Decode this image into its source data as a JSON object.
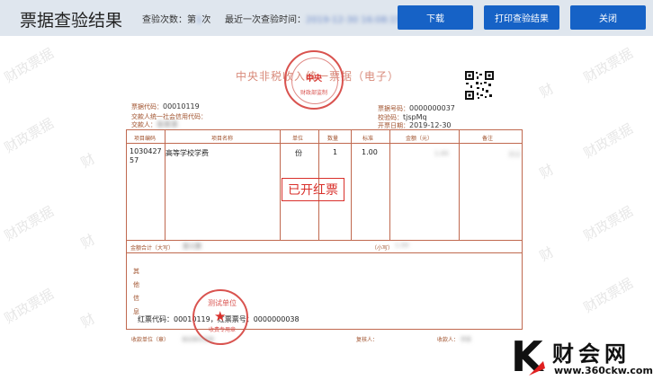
{
  "header": {
    "title": "票据查验结果",
    "check_count_label": "查验次数：",
    "check_count_value_prefix": "第",
    "check_count_value_suffix": "次",
    "check_count_masked": "1",
    "last_check_label": "最近一次查验时间：",
    "last_check_masked": "2019-12-30 16:08:15",
    "buttons": {
      "download": "下载",
      "print": "打印查验结果",
      "close": "关闭"
    }
  },
  "watermark": {
    "text": "财政票据",
    "text_short": "财"
  },
  "invoice": {
    "title": "中央非税收入统一票据（电子）",
    "top_stamp_text": "中央",
    "top_stamp_bottom_text": "财政部监制",
    "code_label": "票据代码：",
    "code_value": "00010119",
    "payer_id_label": "交款人统一社会信用代码：",
    "payer_label": "交款人：",
    "payer_masked": "张某某",
    "number_label": "票据号码：",
    "number_value": "0000000037",
    "checkcode_label": "校验码：",
    "checkcode_value": "tjspMq",
    "date_label": "开票日期：",
    "date_value": "2019-12-30",
    "columns": [
      "项目编码",
      "项目名称",
      "单位",
      "数量",
      "标准",
      "金额（元）",
      "备注"
    ],
    "row": {
      "code": "103042757",
      "name": "高等学校学费",
      "unit": "份",
      "quantity": "1",
      "standard": "1.00",
      "amount_masked": "1.00",
      "remark_masked": "测试"
    },
    "status_stamp": "已开红票",
    "total_upper_label": "金额合计（大写）",
    "total_upper_masked": "壹元整",
    "total_lower_label": "（小写）",
    "total_lower_masked": "1.00",
    "other_info_label": "其他信息",
    "red_info": "红票代码：00010119，红票票号：0000000038",
    "bottom_stamp_top": "测试单位",
    "bottom_stamp_bottom": "收费专用章",
    "payee_unit_label": "收款单位（章）",
    "payee_unit_masked": "测试单位名称",
    "reviewer_label": "复核人：",
    "payee_label": "收款人：",
    "payee_masked": "李某"
  },
  "logo": {
    "letter": "K",
    "name": "财会网",
    "url": "www.360ckw.com"
  }
}
